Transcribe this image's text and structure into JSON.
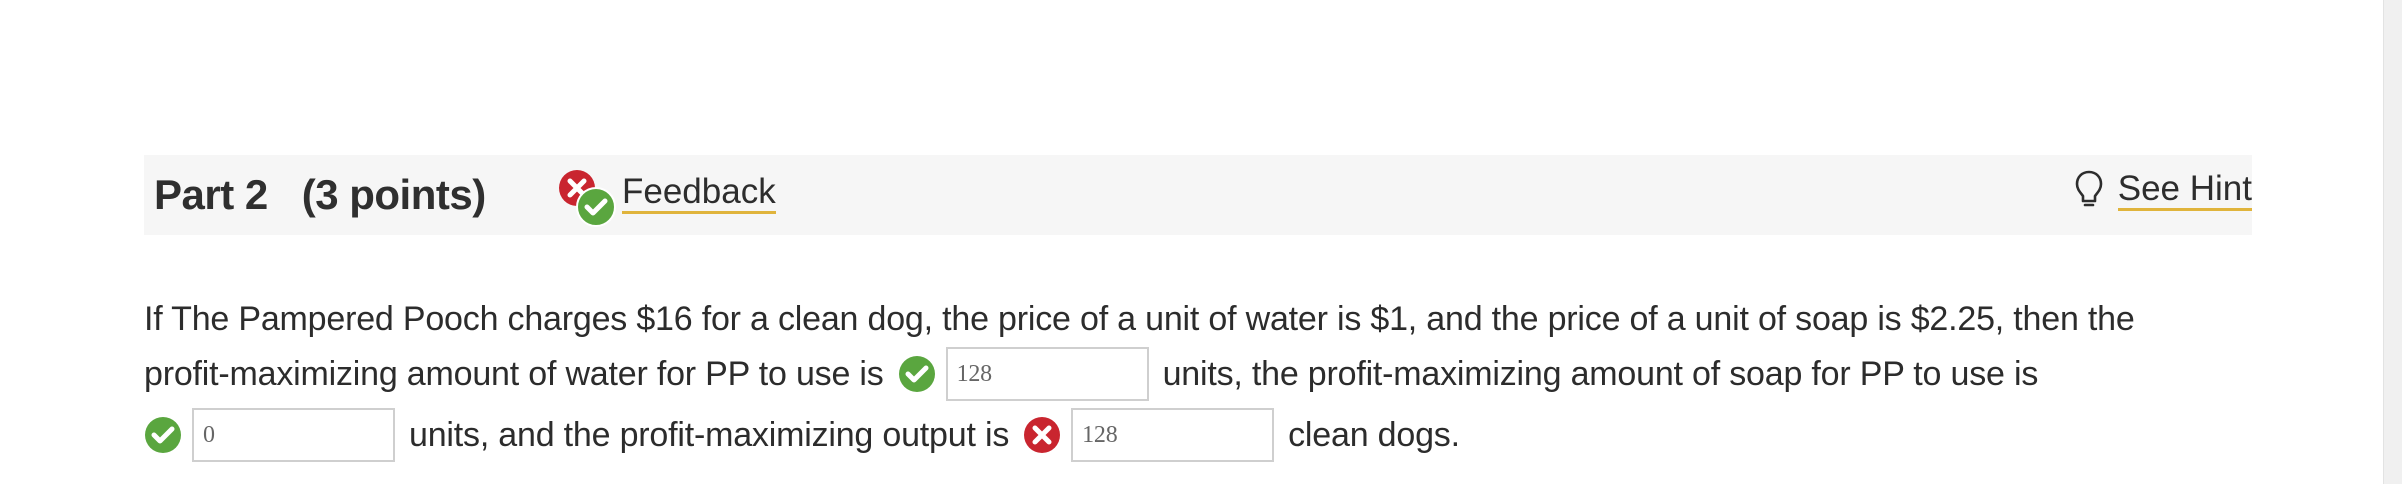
{
  "header": {
    "part_label": "Part 2",
    "points_label": "(3 points)",
    "feedback_label": "Feedback",
    "hint_label": "See Hint"
  },
  "question": {
    "line1": "If The Pampered Pooch charges $16 for a clean dog, the price of a unit of water is $1, and the price of a unit of soap is $2.25, then the",
    "line2_before": "profit-maximizing amount of water for PP to use is",
    "line2_after": "units, the profit-maximizing amount of soap for PP to use is",
    "line3_mid": "units, and the profit-maximizing output is",
    "line3_end": "clean dogs.",
    "answers": {
      "water": "128",
      "soap": "0",
      "output": "128"
    },
    "answer_status": {
      "water": "correct",
      "soap": "correct",
      "output": "incorrect"
    }
  },
  "icons": {
    "feedback": "feedback-mixed-icon",
    "hint": "lightbulb-icon",
    "correct": "check-circle-icon",
    "incorrect": "x-circle-icon"
  },
  "colors": {
    "correct": "#5aa63f",
    "incorrect": "#c9252f",
    "link_underline": "#e0b43c",
    "header_bg": "#f6f6f6"
  }
}
